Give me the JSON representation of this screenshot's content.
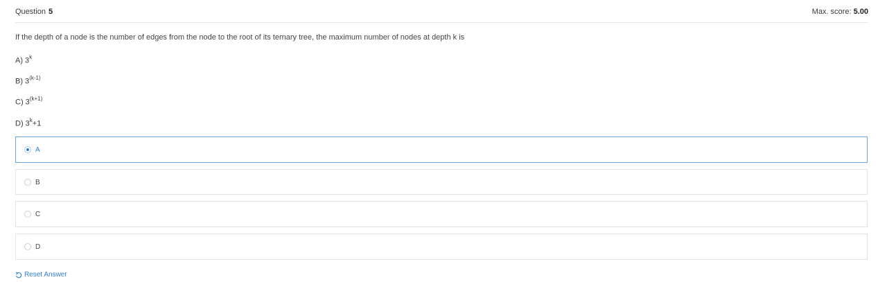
{
  "header": {
    "question_label": "Question",
    "question_number": "5",
    "max_score_label": "Max. score:",
    "max_score_value": "5.00"
  },
  "question": {
    "text": "If the depth of a node is the number of edges from the node to the root of its ternary tree, the maximum number of nodes at depth k is"
  },
  "options_text": [
    {
      "prefix": "A) 3",
      "sup": "k",
      "suffix": ""
    },
    {
      "prefix": "B) 3",
      "sup": "(k-1)",
      "suffix": ""
    },
    {
      "prefix": "C) 3",
      "sup": "(k+1)",
      "suffix": ""
    },
    {
      "prefix": "D) 3",
      "sup": "k",
      "suffix": "+1"
    }
  ],
  "choices": [
    {
      "label": "A",
      "selected": true
    },
    {
      "label": "B",
      "selected": false
    },
    {
      "label": "C",
      "selected": false
    },
    {
      "label": "D",
      "selected": false
    }
  ],
  "reset": {
    "label": "Reset Answer",
    "icon": "undo-icon"
  },
  "colors": {
    "accent": "#2e7fd6",
    "selected_border": "#6aa6e0",
    "border": "#e3e3e3"
  }
}
